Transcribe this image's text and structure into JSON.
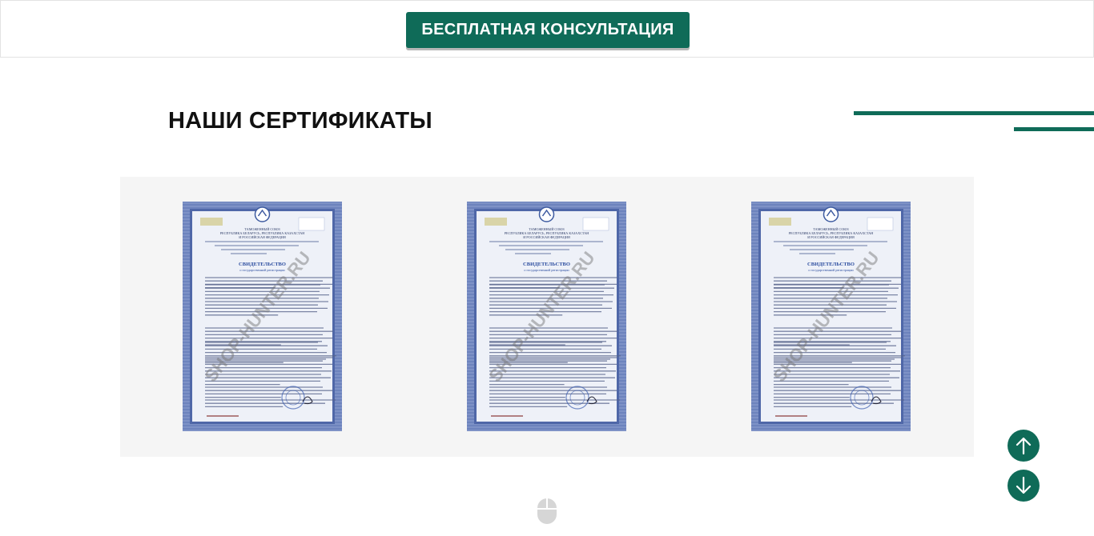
{
  "header": {
    "cta_label": "БЕСПЛАТНАЯ КОНСУЛЬТАЦИЯ"
  },
  "section": {
    "title": "НАШИ СЕРТИФИКАТЫ"
  },
  "certificates": [
    {
      "icon": "certificate-document-icon",
      "heading_lines": [
        "ТАМОЖЕННЫЙ СОЮЗ",
        "РЕСПУБЛИКА БЕЛАРУСЬ, РЕСПУБЛИКА КАЗАХСТАН",
        "И РОССИЙСКАЯ ФЕДЕРАЦИЯ"
      ],
      "doc_title": "СВИДЕТЕЛЬСТВО",
      "doc_subtitle": "о государственной регистрации",
      "watermark": "SHOP-HUNTER.RU"
    },
    {
      "icon": "certificate-document-icon",
      "heading_lines": [
        "ТАМОЖЕННЫЙ СОЮЗ",
        "РЕСПУБЛИКА БЕЛАРУСЬ, РЕСПУБЛИКА КАЗАХСТАН",
        "И РОССИЙСКАЯ ФЕДЕРАЦИЯ"
      ],
      "doc_title": "СВИДЕТЕЛЬСТВО",
      "doc_subtitle": "о государственной регистрации",
      "watermark": "SHOP-HUNTER.RU"
    },
    {
      "icon": "certificate-document-icon",
      "heading_lines": [
        "ТАМОЖЕННЫЙ СОЮЗ",
        "РЕСПУБЛИКА БЕЛАРУСЬ, РЕСПУБЛИКА КАЗАХСТАН",
        "И РОССИЙСКАЯ ФЕДЕРАЦИЯ"
      ],
      "doc_title": "СВИДЕТЕЛЬСТВО",
      "doc_subtitle": "о государственной регистрации",
      "watermark": "SHOP-HUNTER.RU"
    }
  ],
  "scroll": {
    "up_icon": "arrow-up-icon",
    "down_icon": "arrow-down-icon",
    "mouse_icon": "mouse-scroll-icon"
  },
  "colors": {
    "accent": "#0f6b58",
    "cert_border": "#5b74b3",
    "gallery_bg": "#f5f5f5"
  }
}
